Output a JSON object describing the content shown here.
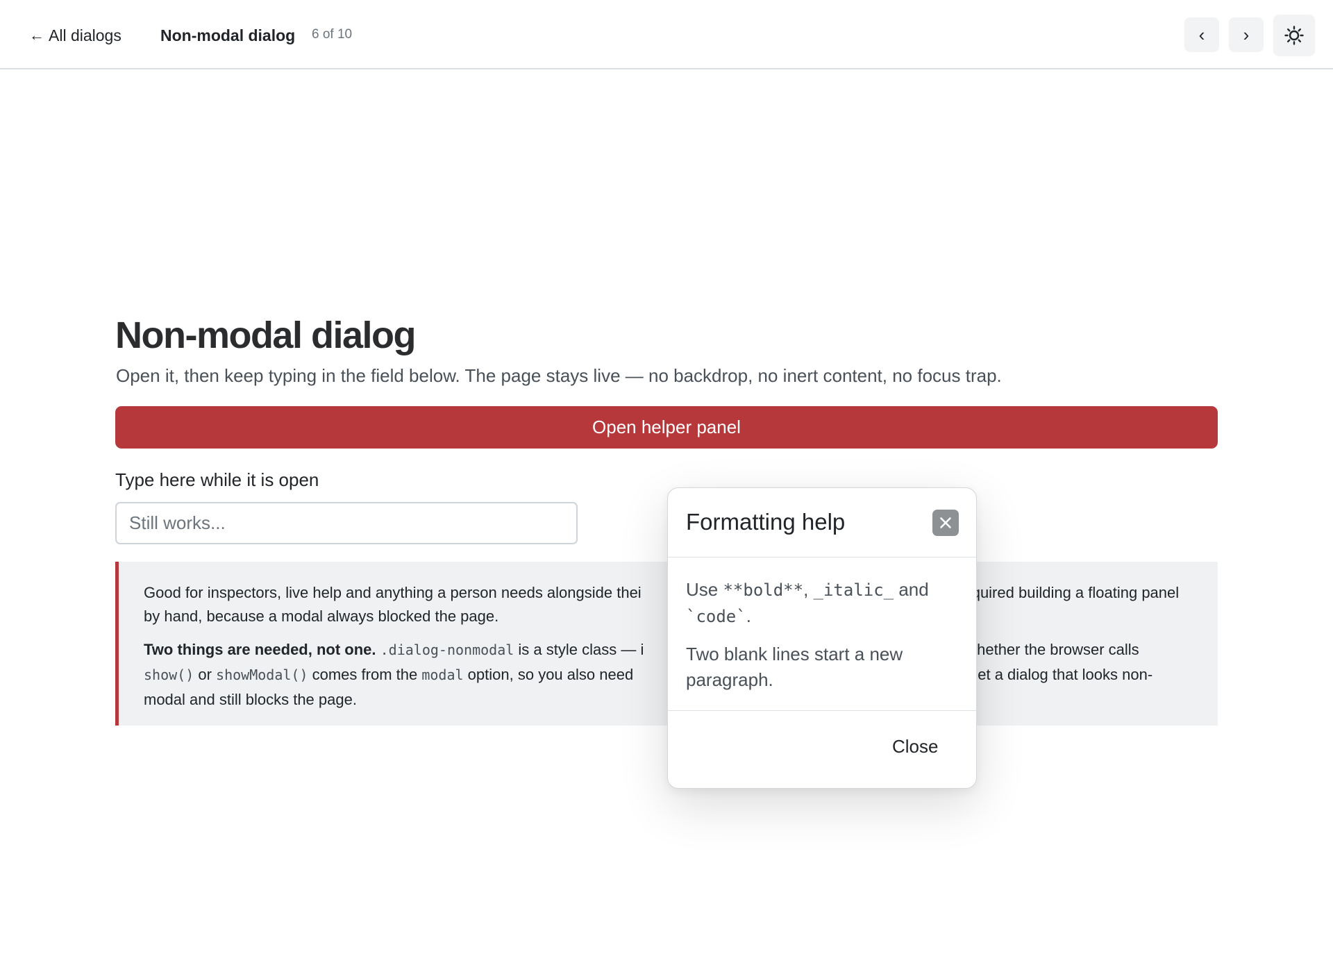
{
  "topbar": {
    "back_label": "All dialogs",
    "title": "Non-modal dialog",
    "position": "6 of 10",
    "prev_glyph": "‹",
    "next_glyph": "›",
    "theme_icon": "sun-icon"
  },
  "main": {
    "title": "Non-modal dialog",
    "lead": "Open it, then keep typing in the field below. The page stays live — no backdrop, no inert content, no focus trap.",
    "open_button": "Open helper panel",
    "field_label": "Type here while it is open",
    "input_value": "",
    "input_placeholder": "Still works..."
  },
  "note": {
    "p1": "Good for inspectors, live help and anything a person needs alongside thei",
    "p1_tail": "quired building a floating panel by hand, because a modal always blocked the page.",
    "p2_strong": "Two things are needed, not one.",
    "p2_code1": ".dialog-nonmodal",
    "p2_t1": " is a style class — i",
    "p2_t2": "Whether the browser calls",
    "p2_code2": "show()",
    "p2_t3": " or ",
    "p2_code3": "showModal()",
    "p2_t4": " comes from the ",
    "p2_code4": "modal",
    "p2_t5": " option, so you also need ",
    "p2_t6": "ss you get a dialog that looks non-modal and still blocks the page."
  },
  "dialog": {
    "title": "Formatting help",
    "use": "Use ",
    "code_bold": "**bold**",
    "comma": ", ",
    "code_italic": "_italic_",
    "and": " and ",
    "code_code": "`code`",
    "period": ".",
    "p2": "Two blank lines start a new paragraph.",
    "close_label": "Close"
  },
  "colors": {
    "accent": "#b7383b",
    "note_bg": "#eff1f3",
    "icon_button_bg": "#f1f3f5"
  }
}
